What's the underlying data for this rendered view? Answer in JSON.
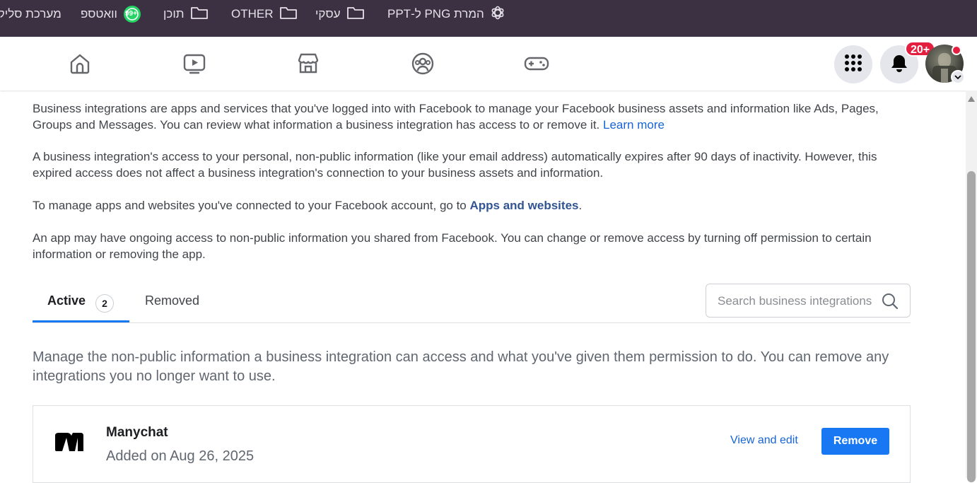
{
  "bookmarks": [
    {
      "label": "המרת PNG ל-PPT",
      "icon": "openai-icon"
    },
    {
      "label": "עסקי",
      "icon": "folder-icon"
    },
    {
      "label": "OTHER",
      "icon": "folder-icon"
    },
    {
      "label": "תוכן",
      "icon": "folder-icon"
    },
    {
      "label": "וואטספ",
      "icon": "whatsapp-icon",
      "badge": "99+"
    },
    {
      "label": "מערכת סליקה",
      "icon": "none"
    }
  ],
  "header": {
    "nav": [
      "home-icon",
      "watch-icon",
      "marketplace-icon",
      "groups-icon",
      "gaming-icon"
    ],
    "notification_badge": "20+",
    "accent": "#1877f2"
  },
  "intro": {
    "p1_text": "Business integrations are apps and services that you've logged into with Facebook to manage your Facebook business assets and information like Ads, Pages, Groups and Messages. You can review what information a business integration has access to or remove it.",
    "p1_link": "Learn more",
    "p2_text": "A business integration's access to your personal, non-public information (like your email address) automatically expires after 90 days of inactivity. However, this expired access does not affect a business integration's connection to your business assets and information.",
    "p3_text": "To manage apps and websites you've connected to your Facebook account, go to",
    "p3_link": "Apps and websites",
    "p3_end": ".",
    "p4_text": "An app may have ongoing access to non-public information you shared from Facebook. You can change or remove access by turning off permission to certain information or removing the app."
  },
  "tabs": {
    "active_label": "Active",
    "active_count": "2",
    "removed_label": "Removed"
  },
  "search": {
    "placeholder": "Search business integrations"
  },
  "manage_text": "Manage the non-public information a business integration can access and what you've given them permission to do. You can remove any integrations you no longer want to use.",
  "integration": {
    "name": "Manychat",
    "added": "Added on Aug 26, 2025",
    "view_edit": "View and edit",
    "remove": "Remove"
  }
}
